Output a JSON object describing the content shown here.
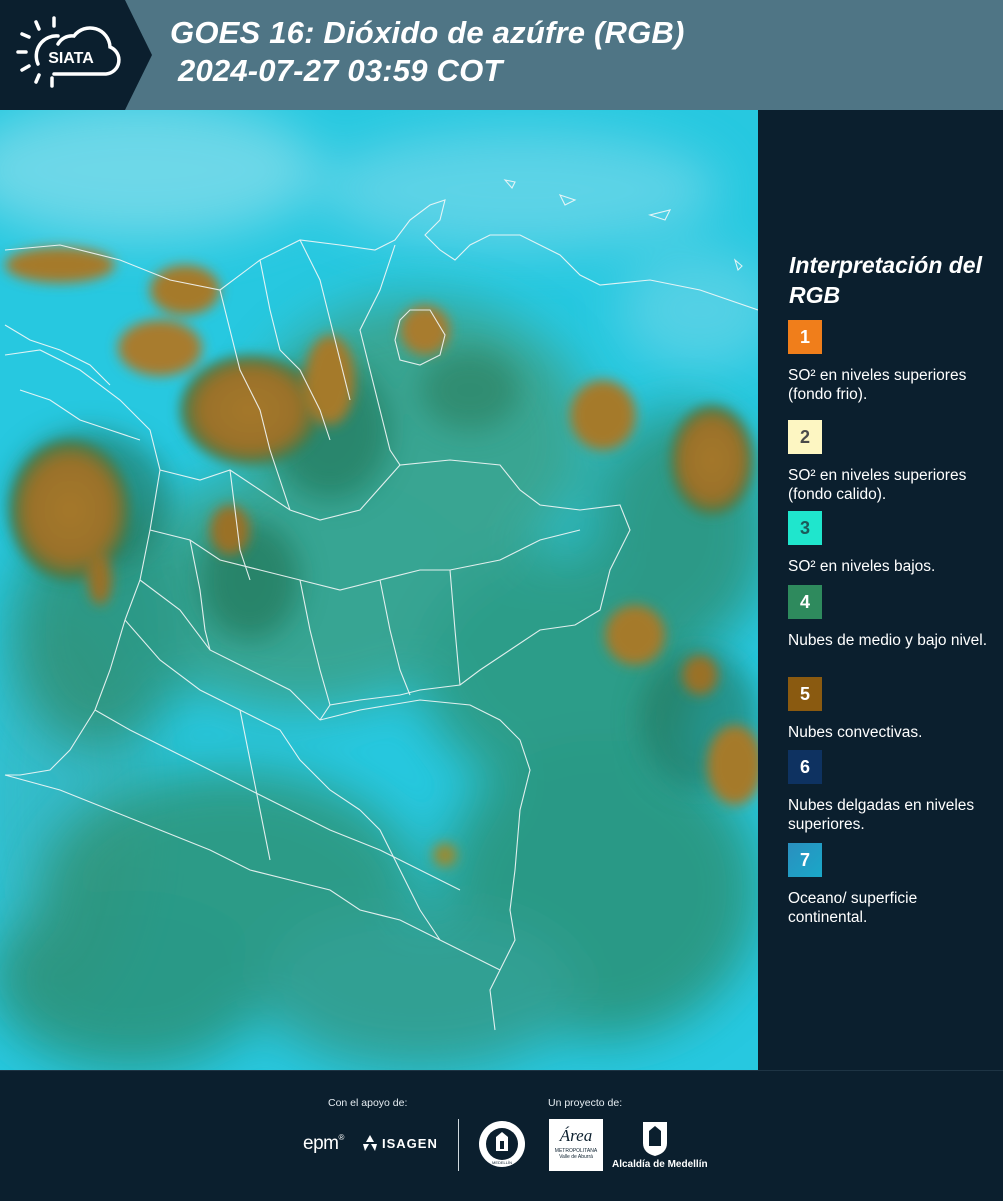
{
  "header": {
    "brand": "SIATA",
    "title_line1": "GOES 16: Dióxido de azúfre (RGB)",
    "title_line2": "2024-07-27 03:59 COT",
    "bg_color": "#4f7585",
    "panel_color": "#0b1f2e"
  },
  "legend": {
    "title": "Interpretación del RGB",
    "items": [
      {
        "num": "1",
        "color": "#f07e1b",
        "num_color": "#ffffff",
        "text": "SO² en niveles superiores (fondo frio)."
      },
      {
        "num": "2",
        "color": "#fdf6c2",
        "num_color": "#4a4a4a",
        "text": "SO² en niveles superiores (fondo calido)."
      },
      {
        "num": "3",
        "color": "#1fe6cd",
        "num_color": "#1c5a5a",
        "text": "SO² en niveles bajos."
      },
      {
        "num": "4",
        "color": "#2e8a5d",
        "num_color": "#ffffff",
        "text": "Nubes de medio y bajo nivel."
      },
      {
        "num": "5",
        "color": "#8a5a10",
        "num_color": "#ffffff",
        "text": "Nubes convectivas."
      },
      {
        "num": "6",
        "color": "#0e3261",
        "num_color": "#ffffff",
        "text": "Nubes delgadas en niveles superiores."
      },
      {
        "num": "7",
        "color": "#2a8fbf",
        "num_color": "#ffffff",
        "text": "Oceano/ superficie continental."
      }
    ]
  },
  "footer": {
    "support_label": "Con el apoyo de:",
    "project_label": "Un proyecto de:",
    "epm": "epm",
    "isagen": "ISAGEN",
    "area_name": "Área",
    "area_sub1": "METROPOLITANA",
    "area_sub2": "Valle de Aburrá",
    "alcaldia": "Alcaldía de Medellín",
    "medellin_seal": "MEDELLÍN"
  }
}
